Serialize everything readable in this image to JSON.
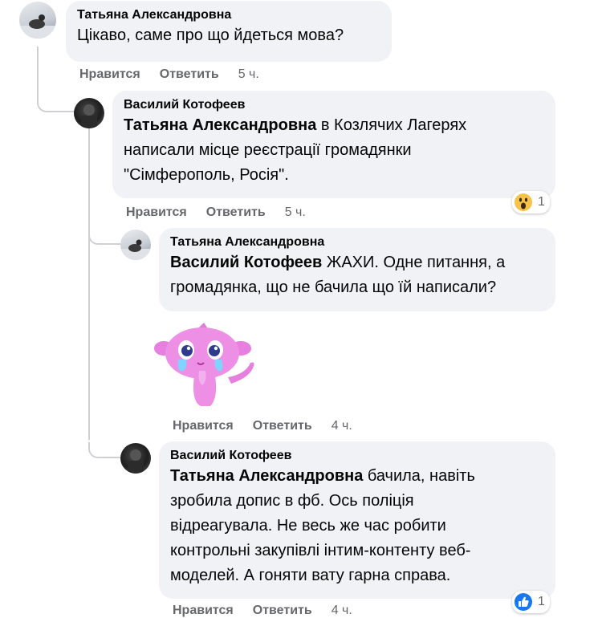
{
  "comments": [
    {
      "author": "Татьяна Александровна",
      "text": "Цікаво, саме про що йдеться мова?",
      "like": "Нравится",
      "reply": "Ответить",
      "time": "5 ч."
    },
    {
      "author": "Василий Котофеев",
      "mention": "Татьяна Александровна",
      "text_line1": " в Козлячих Лагерях",
      "text_line2": "написали місце реєстрації громадянки",
      "text_line3": "\"Сімферополь, Росія\".",
      "like": "Нравится",
      "reply": "Ответить",
      "time": "5 ч.",
      "reaction_icon": "wow-emoji-icon",
      "reaction_count": "1"
    },
    {
      "author": "Татьяна Александровна",
      "mention": "Василий Котофеев",
      "text_line1": " ЖАХИ. Одне питання, а",
      "text_line2": "громадянка, що не бачила що їй написали?",
      "sticker_icon": "crying-pink-creature-sticker-icon",
      "like": "Нравится",
      "reply": "Ответить",
      "time": "4 ч."
    },
    {
      "author": "Василий Котофеев",
      "mention": "Татьяна Александровна",
      "text_line1": " бачила, навіть",
      "text_line2": "зробила допис в фб. Ось поліція",
      "text_line3": "відреагувала. Не весь же час робити",
      "text_line4": "контрольні закупівлі інтим-контенту веб-",
      "text_line5": "моделей. А гоняти вату гарна справа.",
      "like": "Нравится",
      "reply": "Ответить",
      "time": "4 ч.",
      "reaction_icon": "like-thumb-icon",
      "reaction_count": "1"
    }
  ],
  "colors": {
    "bubble": "#f0f2f5",
    "meta": "#65676b",
    "thread_line": "#ced0d4",
    "like_blue": "#1877f2",
    "wow_yellow": "#f7c24a"
  }
}
